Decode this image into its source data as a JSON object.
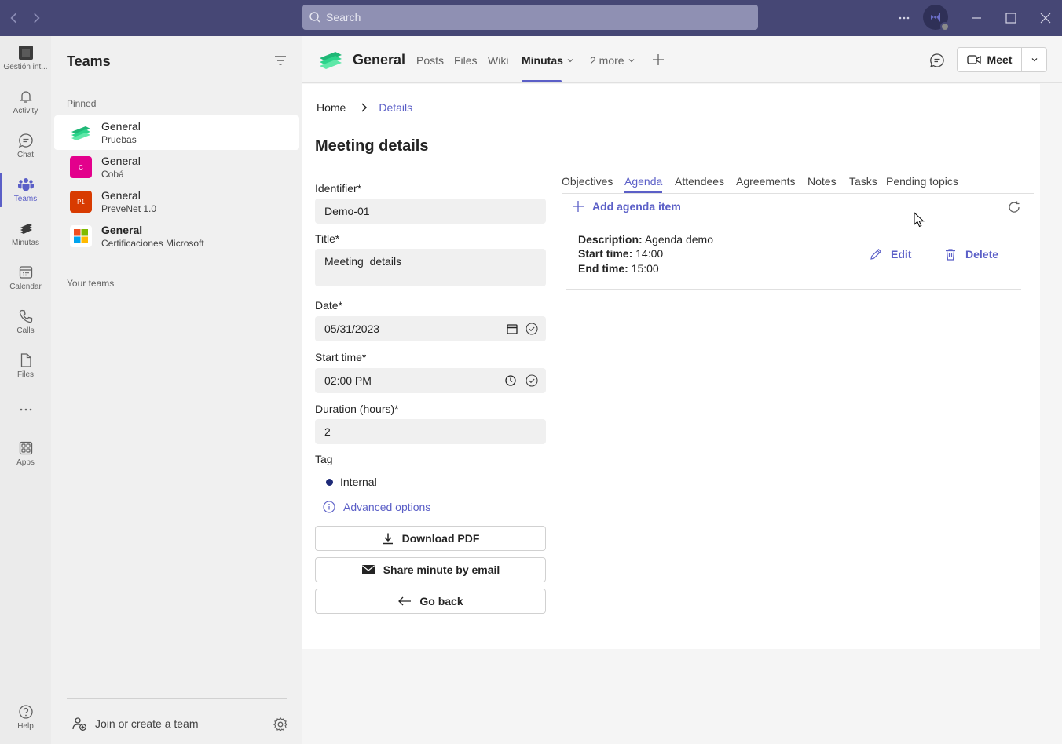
{
  "titlebar": {
    "search_placeholder": "Search",
    "more_label": "···"
  },
  "rail": {
    "items": [
      {
        "label": "Gestión int...",
        "icon": "app-icon"
      },
      {
        "label": "Activity",
        "icon": "bell-icon"
      },
      {
        "label": "Chat",
        "icon": "chat-icon"
      },
      {
        "label": "Teams",
        "icon": "teams-icon"
      },
      {
        "label": "Minutas",
        "icon": "minutas-icon"
      },
      {
        "label": "Calendar",
        "icon": "calendar-icon"
      },
      {
        "label": "Calls",
        "icon": "phone-icon"
      },
      {
        "label": "Files",
        "icon": "file-icon"
      },
      {
        "label": "···",
        "icon": "more-icon"
      },
      {
        "label": "Apps",
        "icon": "apps-icon"
      },
      {
        "label": "Help",
        "icon": "help-icon"
      }
    ]
  },
  "panel": {
    "title": "Teams",
    "pinned_label": "Pinned",
    "your_teams_label": "Your teams",
    "teams": [
      {
        "name": "General",
        "sub": "Pruebas",
        "logo_text": "",
        "color": "#2bd48a"
      },
      {
        "name": "General",
        "sub": "Cobá",
        "logo_text": "C",
        "color": "#e3008c"
      },
      {
        "name": "General",
        "sub": "PreveNet 1.0",
        "logo_text": "P1",
        "color": "#d83b01"
      },
      {
        "name": "General",
        "sub": "Certificaciones Microsoft",
        "logo_text": "",
        "color": "#ffffff"
      }
    ],
    "join_label": "Join or create a team"
  },
  "channel": {
    "title": "General",
    "tabs": [
      "Posts",
      "Files",
      "Wiki",
      "Minutas",
      "2 more"
    ],
    "meet_label": "Meet"
  },
  "content": {
    "breadcrumb_home": "Home",
    "breadcrumb_current": "Details",
    "page_title": "Meeting details",
    "form": {
      "identifier_label": "Identifier*",
      "identifier_value": "Demo-01",
      "title_label": "Title*",
      "title_value": "Meeting  details",
      "date_label": "Date*",
      "date_value": "05/31/2023",
      "start_label": "Start time*",
      "start_value": "02:00 PM",
      "duration_label": "Duration (hours)*",
      "duration_value": "2",
      "tag_label": "Tag",
      "tag_value": "Internal",
      "advanced_label": "Advanced options",
      "download_label": "Download PDF",
      "share_label": "Share minute by email",
      "back_label": "Go back"
    },
    "subtabs": [
      "Objectives",
      "Agenda",
      "Attendees",
      "Agreements",
      "Notes",
      "Tasks",
      "Pending topics"
    ],
    "add_agenda_label": "Add agenda item",
    "agenda_item": {
      "description_label": "Description:",
      "description_value": "Agenda demo",
      "start_label": "Start time:",
      "start_value": "14:00",
      "end_label": "End time:",
      "end_value": "15:00",
      "edit_label": "Edit",
      "delete_label": "Delete"
    }
  },
  "colors": {
    "titlebar": "#464775",
    "accent": "#5b5fc7",
    "tag_dot": "#1e2a78"
  }
}
